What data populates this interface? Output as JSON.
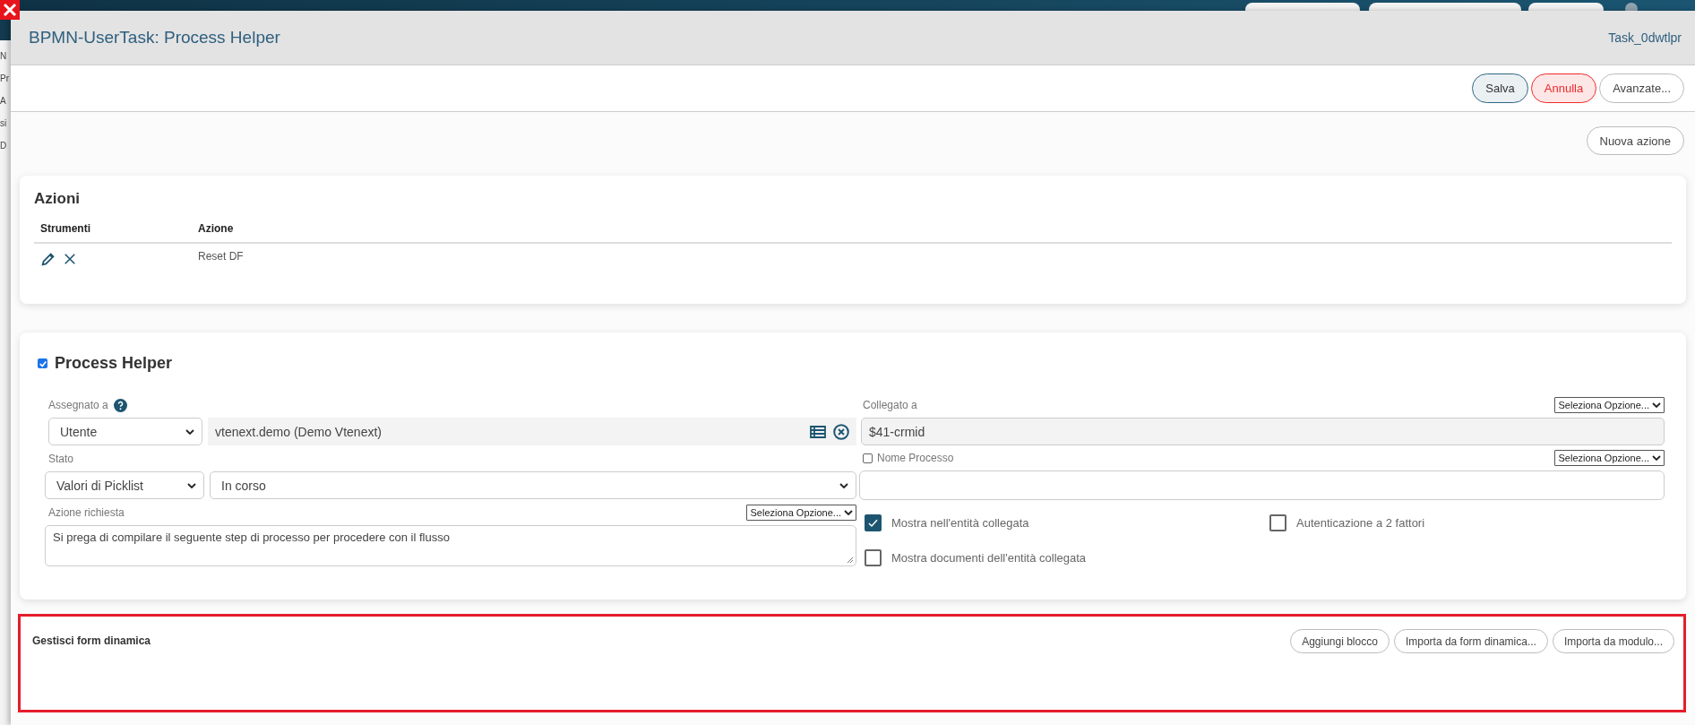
{
  "background": {
    "fragments": [
      "N",
      "Pr",
      "A",
      "si",
      "D"
    ]
  },
  "dialog": {
    "title": "BPMN-UserTask: Process Helper",
    "task_id": "Task_0dwtlpr"
  },
  "toolbar": {
    "buttons": [
      {
        "label": "Salva",
        "kind": "primary"
      },
      {
        "label": "Annulla",
        "kind": "danger"
      },
      {
        "label": "Avanzate...",
        "kind": "default"
      }
    ]
  },
  "new_action_button": "Nuova azione",
  "actions": {
    "title": "Azioni",
    "columns": [
      "Strumenti",
      "Azione"
    ],
    "rows": [
      {
        "action": "Reset DF"
      }
    ]
  },
  "process_helper": {
    "title": "Process Helper",
    "checked": true,
    "assigned": {
      "label": "Assegnato a",
      "type": "Utente",
      "value": "vtenext.demo (Demo Vtenext)"
    },
    "status": {
      "label": "Stato",
      "source": "Valori di Picklist",
      "value": "In corso"
    },
    "request": {
      "label": "Azione richiesta",
      "option": "Seleziona Opzione...",
      "value": "Si prega di compilare il seguente step di processo per procedere con il flusso"
    },
    "linked": {
      "label": "Collegato a",
      "option": "Seleziona Opzione...",
      "value": "$41-crmid"
    },
    "process_name": {
      "label": "Nome Processo",
      "checked": false,
      "option": "Seleziona Opzione..."
    },
    "options": [
      {
        "label": "Mostra nell'entità collegata",
        "checked": true
      },
      {
        "label": "Autenticazione a 2 fattori",
        "checked": false
      },
      {
        "label": "Mostra documenti dell'entità collegata",
        "checked": false
      }
    ]
  },
  "dynamic_form": {
    "title": "Gestisci form dinamica",
    "highlighted": true,
    "buttons": [
      "Aggiungi blocco",
      "Importa da form dinamica...",
      "Importa da modulo..."
    ]
  }
}
